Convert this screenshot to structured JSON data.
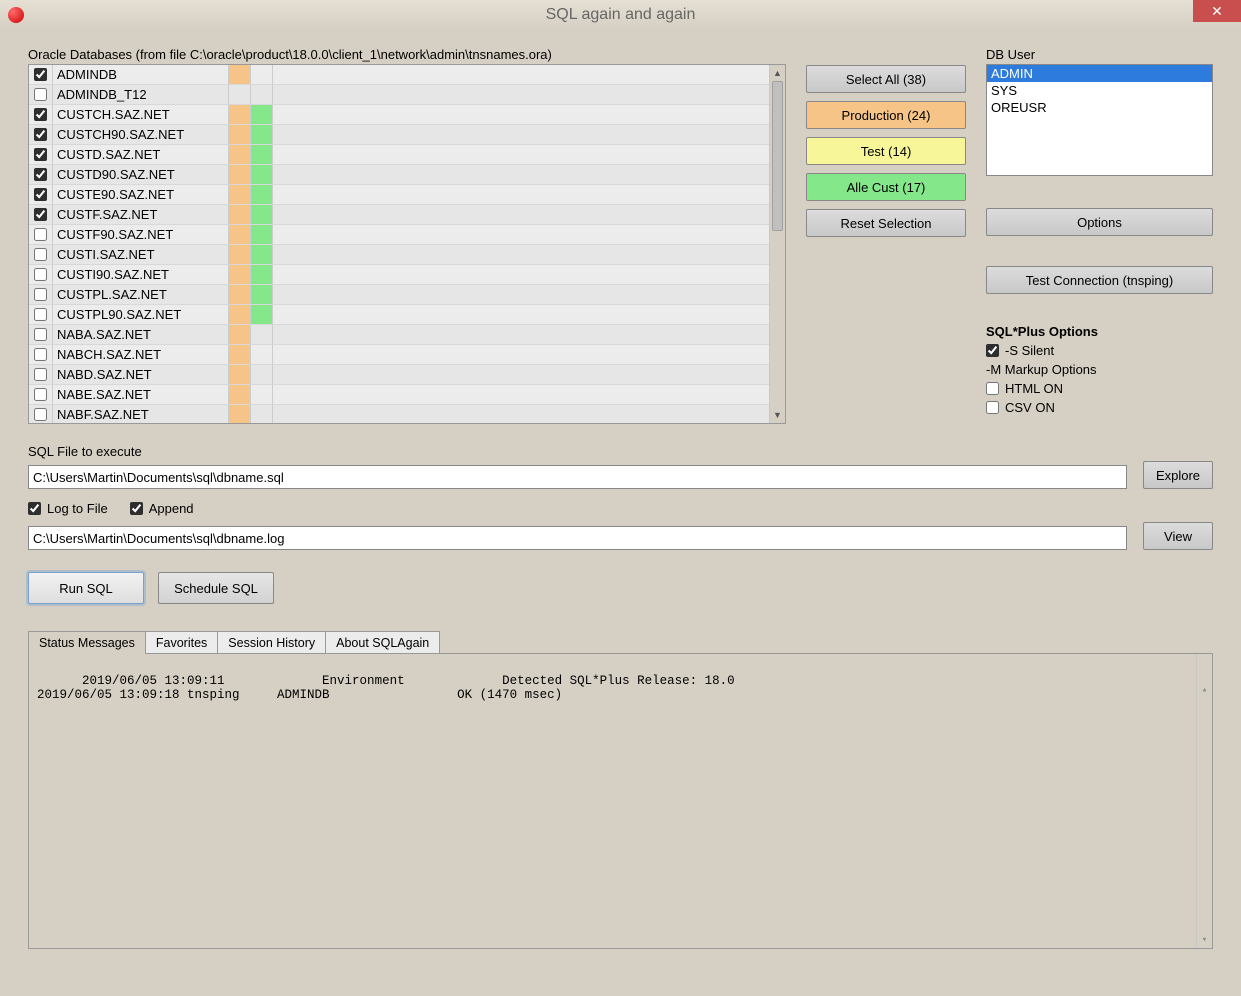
{
  "window": {
    "title": "SQL again and again"
  },
  "dbgrid": {
    "label": "Oracle Databases (from file C:\\oracle\\product\\18.0.0\\client_1\\network\\admin\\tnsnames.ora)",
    "rows": [
      {
        "checked": true,
        "name": "ADMINDB",
        "c1": "orange",
        "c2": ""
      },
      {
        "checked": false,
        "name": "ADMINDB_T12",
        "c1": "",
        "c2": ""
      },
      {
        "checked": true,
        "name": "CUSTCH.SAZ.NET",
        "c1": "orange",
        "c2": "green"
      },
      {
        "checked": true,
        "name": "CUSTCH90.SAZ.NET",
        "c1": "orange",
        "c2": "green"
      },
      {
        "checked": true,
        "name": "CUSTD.SAZ.NET",
        "c1": "orange",
        "c2": "green"
      },
      {
        "checked": true,
        "name": "CUSTD90.SAZ.NET",
        "c1": "orange",
        "c2": "green"
      },
      {
        "checked": true,
        "name": "CUSTE90.SAZ.NET",
        "c1": "orange",
        "c2": "green"
      },
      {
        "checked": true,
        "name": "CUSTF.SAZ.NET",
        "c1": "orange",
        "c2": "green"
      },
      {
        "checked": false,
        "name": "CUSTF90.SAZ.NET",
        "c1": "orange",
        "c2": "green"
      },
      {
        "checked": false,
        "name": "CUSTI.SAZ.NET",
        "c1": "orange",
        "c2": "green"
      },
      {
        "checked": false,
        "name": "CUSTI90.SAZ.NET",
        "c1": "orange",
        "c2": "green"
      },
      {
        "checked": false,
        "name": "CUSTPL.SAZ.NET",
        "c1": "orange",
        "c2": "green"
      },
      {
        "checked": false,
        "name": "CUSTPL90.SAZ.NET",
        "c1": "orange",
        "c2": "green"
      },
      {
        "checked": false,
        "name": "NABA.SAZ.NET",
        "c1": "orange",
        "c2": ""
      },
      {
        "checked": false,
        "name": "NABCH.SAZ.NET",
        "c1": "orange",
        "c2": ""
      },
      {
        "checked": false,
        "name": "NABD.SAZ.NET",
        "c1": "orange",
        "c2": ""
      },
      {
        "checked": false,
        "name": "NABE.SAZ.NET",
        "c1": "orange",
        "c2": ""
      },
      {
        "checked": false,
        "name": "NABF.SAZ.NET",
        "c1": "orange",
        "c2": ""
      }
    ]
  },
  "selbuttons": {
    "select_all": "Select All (38)",
    "production": "Production (24)",
    "test": "Test (14)",
    "alle_cust": "Alle Cust (17)",
    "reset": "Reset Selection"
  },
  "dbuser": {
    "label": "DB User",
    "items": [
      "ADMIN",
      "SYS",
      "OREUSR"
    ],
    "selected": 0
  },
  "side": {
    "options": "Options",
    "testconn": "Test Connection (tnsping)"
  },
  "sqlplus": {
    "header": "SQL*Plus Options",
    "silent_checked": true,
    "silent_label": "-S Silent",
    "markup_label": "-M Markup Options",
    "html_checked": false,
    "html_label": "HTML ON",
    "csv_checked": false,
    "csv_label": "CSV ON"
  },
  "exec": {
    "file_label": "SQL File to execute",
    "file_value": "C:\\Users\\Martin\\Documents\\sql\\dbname.sql",
    "explore": "Explore",
    "log_to_file_checked": true,
    "log_to_file_label": "Log to File",
    "append_checked": true,
    "append_label": "Append",
    "log_value": "C:\\Users\\Martin\\Documents\\sql\\dbname.log",
    "view": "View",
    "run": "Run SQL",
    "schedule": "Schedule SQL"
  },
  "tabs": {
    "items": [
      "Status Messages",
      "Favorites",
      "Session History",
      "About SQLAgain"
    ],
    "active": 0,
    "content": "2019/06/05 13:09:11             Environment             Detected SQL*Plus Release: 18.0\n2019/06/05 13:09:18 tnsping     ADMINDB                 OK (1470 msec)"
  }
}
